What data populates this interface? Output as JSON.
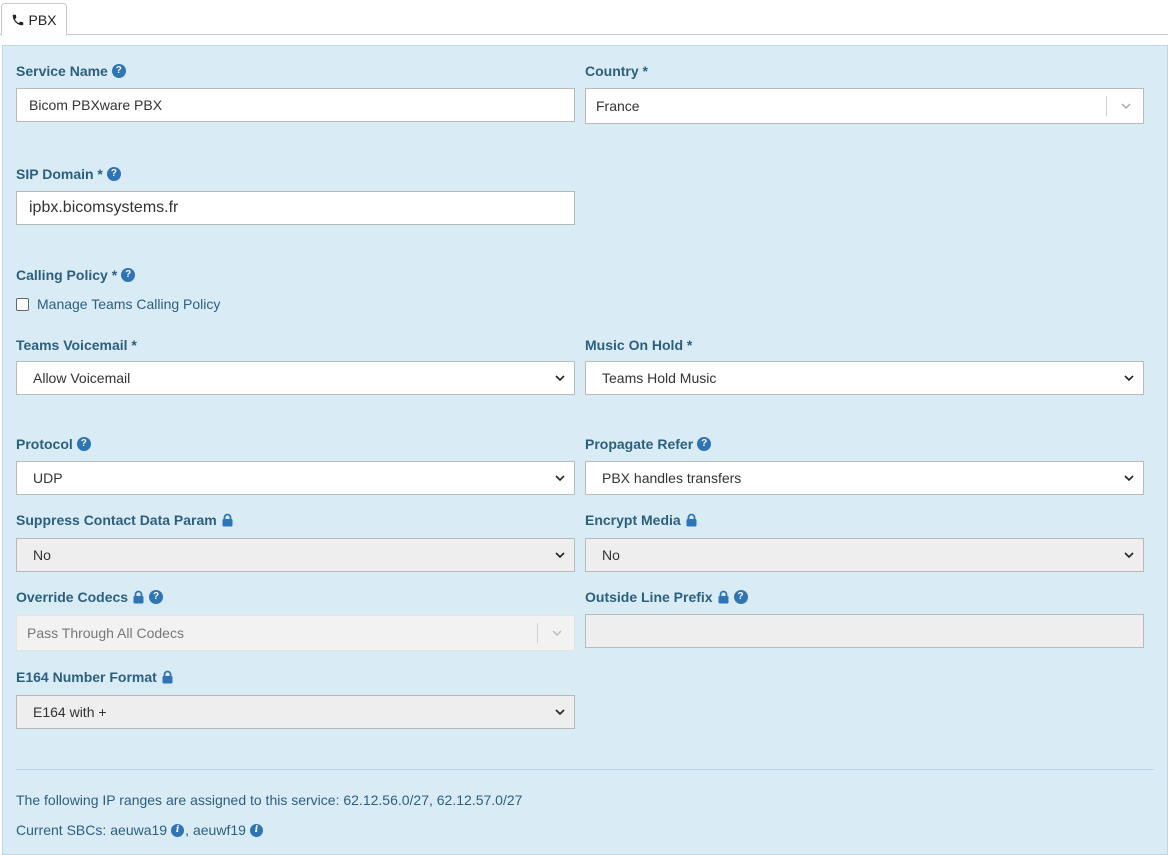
{
  "tab": {
    "icon": "phone-icon",
    "label": "PBX"
  },
  "fields": {
    "service_name": {
      "label": "Service Name",
      "value": "Bicom PBXware PBX"
    },
    "country": {
      "label": "Country *",
      "value": "France"
    },
    "sip_domain": {
      "label": "SIP Domain *",
      "value": "ipbx.bicomsystems.fr"
    },
    "calling_policy": {
      "label": "Calling Policy *",
      "checkbox_label": "Manage Teams Calling Policy"
    },
    "teams_voicemail": {
      "label": "Teams Voicemail *",
      "value": "Allow Voicemail"
    },
    "music_on_hold": {
      "label": "Music On Hold *",
      "value": "Teams Hold Music"
    },
    "protocol": {
      "label": "Protocol",
      "value": "UDP"
    },
    "propagate_refer": {
      "label": "Propagate Refer",
      "value": "PBX handles transfers"
    },
    "suppress_contact": {
      "label": "Suppress Contact Data Param",
      "value": "No"
    },
    "encrypt_media": {
      "label": "Encrypt Media",
      "value": "No"
    },
    "override_codecs": {
      "label": "Override Codecs",
      "value": "Pass Through All Codecs"
    },
    "outside_line_prefix": {
      "label": "Outside Line Prefix",
      "value": ""
    },
    "e164_format": {
      "label": "E164 Number Format",
      "value": "E164 with +"
    }
  },
  "footer": {
    "ip_ranges_text": "The following IP ranges are assigned to this service: 62.12.56.0/27, 62.12.57.0/27",
    "sbcs_prefix": "Current SBCs:",
    "sbc1": "aeuwa19",
    "sbc_sep": ",",
    "sbc2": "aeuwf19"
  },
  "colors": {
    "panel_bg": "#d9ecf6",
    "label": "#2c5f7e",
    "help_icon": "#2f74b5"
  }
}
